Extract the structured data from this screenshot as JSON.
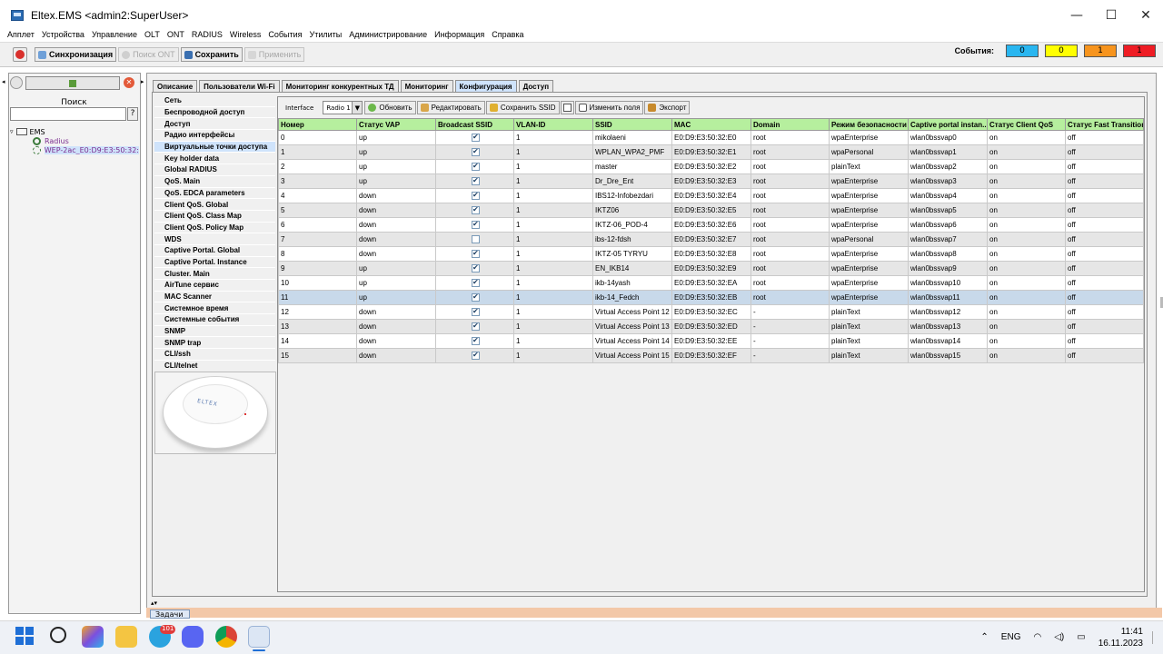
{
  "window": {
    "title": "Eltex.EMS <admin2:SuperUser>",
    "controls": [
      "—",
      "☐",
      "✕"
    ]
  },
  "menu": [
    "Апплет",
    "Устройства",
    "Управление",
    "OLT",
    "ONT",
    "RADIUS",
    "Wireless",
    "События",
    "Утилиты",
    "Администрирование",
    "Информация",
    "Справка"
  ],
  "toolbar": {
    "sync": "Синхронизация",
    "search_ont": "Поиск ONT",
    "save": "Сохранить",
    "apply": "Применить"
  },
  "events": {
    "label": "События:",
    "boxes": [
      {
        "value": "0",
        "color": "#29b6f0"
      },
      {
        "value": "0",
        "color": "#ffff00"
      },
      {
        "value": "1",
        "color": "#f7941d"
      },
      {
        "value": "1",
        "color": "#ee1c24"
      }
    ]
  },
  "left": {
    "search_label": "Поиск",
    "search_btn": "?",
    "tree": {
      "root": "EMS",
      "radius": "Radius",
      "device": "WEP-2ac_E0:D9:E3:50:32:"
    }
  },
  "tabs": [
    "Описание",
    "Пользователи Wi-Fi",
    "Мониторинг конкурентных ТД",
    "Мониторинг",
    "Конфигурация",
    "Доступ"
  ],
  "active_tab": 4,
  "side_menu": [
    "Сеть",
    "Беспроводной доступ",
    "Доступ",
    "Радио интерфейсы",
    "Виртуальные точки доступа",
    "Key holder data",
    "Global RADIUS",
    "QoS. Main",
    "QoS. EDCA parameters",
    "Client QoS. Global",
    "Client QoS. Class Map",
    "Client QoS. Policy Map",
    "WDS",
    "Captive Portal. Global",
    "Captive Portal. Instance",
    "Cluster. Main",
    "AirTune сервис",
    "MAC Scanner",
    "Системное время",
    "Системные события",
    "SNMP",
    "SNMP trap",
    "CLI/ssh",
    "CLI/telnet"
  ],
  "active_side": 4,
  "device_logo": "ELTEX",
  "table_toolbar": {
    "interface_label": "Interface",
    "interface_value": "Radio 1",
    "refresh": "Обновить",
    "edit": "Редактировать",
    "save_ssid": "Сохранить SSID",
    "change_fields": "Изменить поля",
    "export": "Экспорт"
  },
  "columns": [
    "Номер",
    "Статус VAP",
    "Broadcast SSID",
    "VLAN-ID",
    "SSID",
    "MAC",
    "Domain",
    "Режим безопасности",
    "Captive portal instan...",
    "Статус Client QoS",
    "Статус Fast Transition"
  ],
  "rows": [
    {
      "n": "0",
      "vap": "up",
      "bc": true,
      "vlan": "1",
      "ssid": "mikolaeni",
      "mac": "E0:D9:E3:50:32:E0",
      "dom": "root",
      "sec": "wpaEnterprise",
      "cp": "wlan0bssvap0",
      "qos": "on",
      "ft": "off"
    },
    {
      "n": "1",
      "vap": "up",
      "bc": true,
      "vlan": "1",
      "ssid": "WPLAN_WPA2_PMF",
      "mac": "E0:D9:E3:50:32:E1",
      "dom": "root",
      "sec": "wpaPersonal",
      "cp": "wlan0bssvap1",
      "qos": "on",
      "ft": "off"
    },
    {
      "n": "2",
      "vap": "up",
      "bc": true,
      "vlan": "1",
      "ssid": "master",
      "mac": "E0:D9:E3:50:32:E2",
      "dom": "root",
      "sec": "plainText",
      "cp": "wlan0bssvap2",
      "qos": "on",
      "ft": "off"
    },
    {
      "n": "3",
      "vap": "up",
      "bc": true,
      "vlan": "1",
      "ssid": "Dr_Dre_Ent",
      "mac": "E0:D9:E3:50:32:E3",
      "dom": "root",
      "sec": "wpaEnterprise",
      "cp": "wlan0bssvap3",
      "qos": "on",
      "ft": "off"
    },
    {
      "n": "4",
      "vap": "down",
      "bc": true,
      "vlan": "1",
      "ssid": "IBS12-Infobezdari",
      "mac": "E0:D9:E3:50:32:E4",
      "dom": "root",
      "sec": "wpaEnterprise",
      "cp": "wlan0bssvap4",
      "qos": "on",
      "ft": "off"
    },
    {
      "n": "5",
      "vap": "down",
      "bc": true,
      "vlan": "1",
      "ssid": "IKTZ06",
      "mac": "E0:D9:E3:50:32:E5",
      "dom": "root",
      "sec": "wpaEnterprise",
      "cp": "wlan0bssvap5",
      "qos": "on",
      "ft": "off"
    },
    {
      "n": "6",
      "vap": "down",
      "bc": true,
      "vlan": "1",
      "ssid": "IKTZ-06_POD-4",
      "mac": "E0:D9:E3:50:32:E6",
      "dom": "root",
      "sec": "wpaEnterprise",
      "cp": "wlan0bssvap6",
      "qos": "on",
      "ft": "off"
    },
    {
      "n": "7",
      "vap": "down",
      "bc": false,
      "vlan": "1",
      "ssid": "ibs-12-fdsh",
      "mac": "E0:D9:E3:50:32:E7",
      "dom": "root",
      "sec": "wpaPersonal",
      "cp": "wlan0bssvap7",
      "qos": "on",
      "ft": "off"
    },
    {
      "n": "8",
      "vap": "down",
      "bc": true,
      "vlan": "1",
      "ssid": "IKTZ-05 TYRYU",
      "mac": "E0:D9:E3:50:32:E8",
      "dom": "root",
      "sec": "wpaEnterprise",
      "cp": "wlan0bssvap8",
      "qos": "on",
      "ft": "off"
    },
    {
      "n": "9",
      "vap": "up",
      "bc": true,
      "vlan": "1",
      "ssid": "EN_IKB14",
      "mac": "E0:D9:E3:50:32:E9",
      "dom": "root",
      "sec": "wpaEnterprise",
      "cp": "wlan0bssvap9",
      "qos": "on",
      "ft": "off"
    },
    {
      "n": "10",
      "vap": "up",
      "bc": true,
      "vlan": "1",
      "ssid": "ikb-14yash",
      "mac": "E0:D9:E3:50:32:EA",
      "dom": "root",
      "sec": "wpaEnterprise",
      "cp": "wlan0bssvap10",
      "qos": "on",
      "ft": "off"
    },
    {
      "n": "11",
      "vap": "up",
      "bc": true,
      "vlan": "1",
      "ssid": "ikb-14_Fedch",
      "mac": "E0:D9:E3:50:32:EB",
      "dom": "root",
      "sec": "wpaEnterprise",
      "cp": "wlan0bssvap11",
      "qos": "on",
      "ft": "off"
    },
    {
      "n": "12",
      "vap": "down",
      "bc": true,
      "vlan": "1",
      "ssid": "Virtual Access Point 12",
      "mac": "E0:D9:E3:50:32:EC",
      "dom": "-",
      "sec": "plainText",
      "cp": "wlan0bssvap12",
      "qos": "on",
      "ft": "off"
    },
    {
      "n": "13",
      "vap": "down",
      "bc": true,
      "vlan": "1",
      "ssid": "Virtual Access Point 13",
      "mac": "E0:D9:E3:50:32:ED",
      "dom": "-",
      "sec": "plainText",
      "cp": "wlan0bssvap13",
      "qos": "on",
      "ft": "off"
    },
    {
      "n": "14",
      "vap": "down",
      "bc": true,
      "vlan": "1",
      "ssid": "Virtual Access Point 14",
      "mac": "E0:D9:E3:50:32:EE",
      "dom": "-",
      "sec": "plainText",
      "cp": "wlan0bssvap14",
      "qos": "on",
      "ft": "off"
    },
    {
      "n": "15",
      "vap": "down",
      "bc": true,
      "vlan": "1",
      "ssid": "Virtual Access Point 15",
      "mac": "E0:D9:E3:50:32:EF",
      "dom": "-",
      "sec": "plainText",
      "cp": "wlan0bssvap15",
      "qos": "on",
      "ft": "off"
    }
  ],
  "selected_row": 11,
  "tasks_label": "Задачи",
  "taskbar": {
    "telegram_badge": "101",
    "lang": "ENG",
    "time": "11:41",
    "date": "16.11.2023"
  }
}
